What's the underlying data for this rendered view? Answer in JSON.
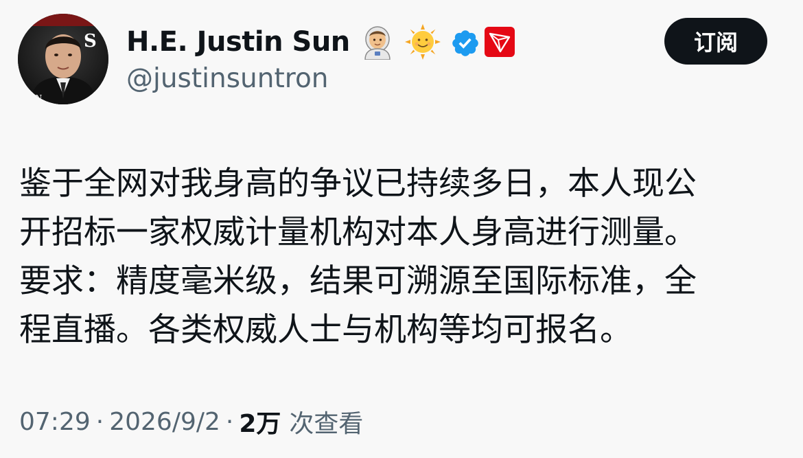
{
  "author": {
    "display_name": "H.E. Justin Sun",
    "handle": "@justinsuntron",
    "name_icons": [
      "astronaut-emoji",
      "sun-emoji",
      "verified-badge",
      "tron-logo"
    ],
    "verified_color": "#1d9bf0",
    "tron_color": "#e50915"
  },
  "actions": {
    "subscribe_label": "订阅"
  },
  "tweet": {
    "lines": [
      "鉴于全网对我身高的争议已持续多日，本人现公",
      "开招标一家权威计量机构对本人身高进行测量。",
      "要求：精度毫米级，结果可溯源至国际标准，全",
      "程直播。各类权威人士与机构等均可报名。"
    ]
  },
  "meta": {
    "time": "07:29",
    "separator": "·",
    "date": "2026/9/2",
    "views_count": "2万",
    "views_label": "次查看"
  }
}
